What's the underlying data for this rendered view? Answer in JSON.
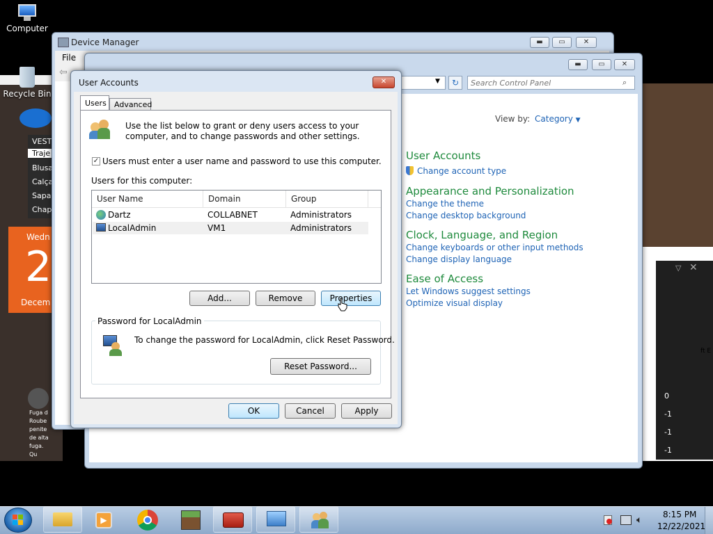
{
  "desktop": {
    "computer_label": "Computer",
    "recycle_label": "Recycle Bin"
  },
  "bg_fragments": {
    "shop_items": [
      "VEST",
      "Traje",
      "Blusa",
      "Calça",
      "Sapa",
      "Chap"
    ],
    "calendar_day_name": "Wedn",
    "calendar_day_num": "2",
    "calendar_month": "Decem",
    "news_text": "Fuga d Roube penite de alta fuga. Qu despistac",
    "right_numbers": [
      "0",
      "-1",
      "-1",
      "-1"
    ],
    "right_snippet": "ft E"
  },
  "device_manager": {
    "title": "Device Manager",
    "menu_file": "File"
  },
  "control_panel": {
    "search_placeholder": "Search Control Panel",
    "view_by_label": "View by:",
    "view_by_value": "Category",
    "sections": [
      {
        "heading": "User Accounts",
        "links": [
          "Change account type"
        ]
      },
      {
        "heading": "Appearance and Personalization",
        "links": [
          "Change the theme",
          "Change desktop background"
        ]
      },
      {
        "heading": "Clock, Language, and Region",
        "links": [
          "Change keyboards or other input methods",
          "Change display language"
        ]
      },
      {
        "heading": "Ease of Access",
        "links": [
          "Let Windows suggest settings",
          "Optimize visual display"
        ]
      }
    ]
  },
  "dialog": {
    "title": "User Accounts",
    "tabs": [
      "Users",
      "Advanced"
    ],
    "intro": "Use the list below to grant or deny users access to your computer, and to change passwords and other settings.",
    "checkbox_label": "Users must enter a user name and password to use this computer.",
    "checkbox_checked": true,
    "users_label": "Users for this computer:",
    "columns": [
      "User Name",
      "Domain",
      "Group"
    ],
    "rows": [
      {
        "name": "Dartz",
        "domain": "COLLABNET",
        "group": "Administrators"
      },
      {
        "name": "LocalAdmin",
        "domain": "VM1",
        "group": "Administrators"
      }
    ],
    "add_button": "Add...",
    "remove_button": "Remove",
    "properties_button": "Properties",
    "password_group": "Password for LocalAdmin",
    "password_text": "To change the password for LocalAdmin, click Reset Password.",
    "reset_button": "Reset Password...",
    "ok_button": "OK",
    "cancel_button": "Cancel",
    "apply_button": "Apply"
  },
  "taskbar": {
    "time": "8:15 PM",
    "date": "12/22/2021"
  }
}
